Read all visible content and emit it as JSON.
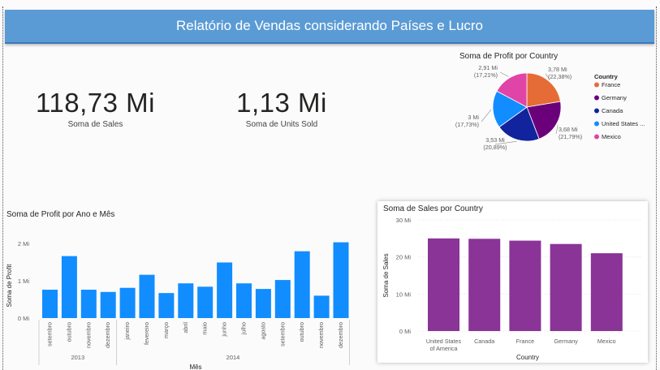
{
  "report": {
    "title": "Relatório de Vendas considerando Países e Lucro"
  },
  "kpis": [
    {
      "value": "118,73 Mi",
      "label": "Soma de  Sales"
    },
    {
      "value": "1,13 Mi",
      "label": "Soma de Units Sold"
    }
  ],
  "chart_data": [
    {
      "type": "pie",
      "title": "Soma de Profit por Country",
      "legend_title": "Country",
      "legend_position": "right",
      "categories": [
        "France",
        "Germany",
        "Canada",
        "United States ...",
        "Mexico"
      ],
      "values": [
        3.78,
        3.68,
        3.53,
        3.0,
        2.91
      ],
      "value_labels": [
        "3,78 Mi\n(22,38%)",
        "3,68 Mi\n(21,79%)",
        "3,53 Mi\n(20,89%)",
        "3 Mi\n(17,73%)",
        "2,91 Mi\n(17,21%)"
      ],
      "colors": [
        "#e66c37",
        "#6b007b",
        "#12239e",
        "#118dff",
        "#e044a7"
      ]
    },
    {
      "type": "bar",
      "title": "Soma de Profit por Ano e Mês",
      "xlabel": "Mês",
      "ylabel": "Soma de Profit",
      "ylim": [
        0,
        2.1
      ],
      "yticks": [
        "0 Mi",
        "1 Mi",
        "2 Mi"
      ],
      "grid": false,
      "categories": [
        "setembro",
        "outubro",
        "novembro",
        "dezembro",
        "janeiro",
        "fevereiro",
        "março",
        "abril",
        "maio",
        "junho",
        "julho",
        "agosto",
        "setembro",
        "outubro",
        "novembro",
        "dezembro"
      ],
      "groups": [
        {
          "label": "2013",
          "count": 4
        },
        {
          "label": "2014",
          "count": 12
        }
      ],
      "values": [
        0.76,
        1.66,
        0.76,
        0.7,
        0.81,
        1.16,
        0.67,
        0.93,
        0.84,
        1.49,
        0.93,
        0.78,
        1.02,
        1.79,
        0.6,
        2.03
      ],
      "color": "#118dff"
    },
    {
      "type": "bar",
      "title": "Soma de Sales por Country",
      "xlabel": "Country",
      "ylabel": "Soma de Sales",
      "ylim": [
        0,
        30
      ],
      "yticks": [
        "0 Mi",
        "10 Mi",
        "20 Mi",
        "30 Mi"
      ],
      "grid": true,
      "categories": [
        "United States of America",
        "Canada",
        "France",
        "Germany",
        "Mexico"
      ],
      "values": [
        25.0,
        24.9,
        24.4,
        23.5,
        21.0
      ],
      "color": "#8a3497"
    }
  ]
}
